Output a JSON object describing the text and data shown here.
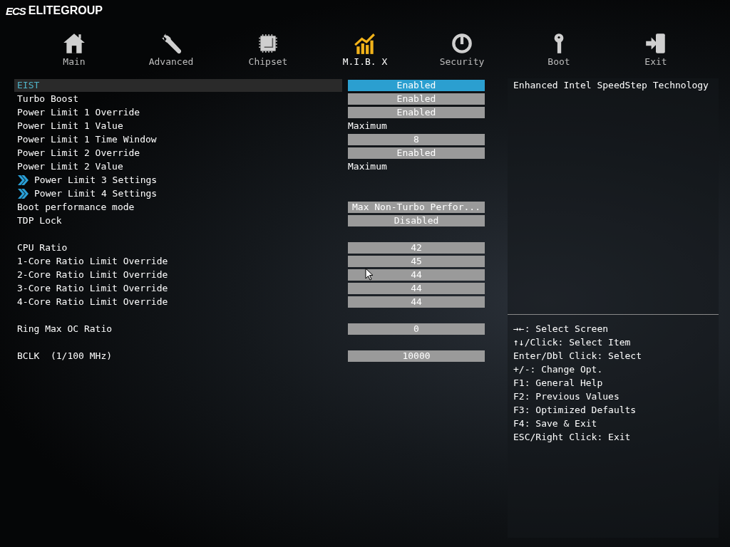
{
  "brand": {
    "logo": "ECS",
    "name": "ELITEGROUP"
  },
  "tabs": [
    {
      "label": "Main",
      "selected": false
    },
    {
      "label": "Advanced",
      "selected": false
    },
    {
      "label": "Chipset",
      "selected": false
    },
    {
      "label": "M.I.B. X",
      "selected": true
    },
    {
      "label": "Security",
      "selected": false
    },
    {
      "label": "Boot",
      "selected": false
    },
    {
      "label": "Exit",
      "selected": false
    }
  ],
  "setting_groups": [
    {
      "items": [
        {
          "kind": "option",
          "label": "EIST",
          "value": "Enabled",
          "selected": true
        },
        {
          "kind": "option",
          "label": "Turbo Boost",
          "value": "Enabled",
          "selected": false
        },
        {
          "kind": "option",
          "label": "Power Limit 1 Override",
          "value": "Enabled",
          "selected": false
        },
        {
          "kind": "text",
          "label": "Power Limit 1 Value",
          "value": "Maximum",
          "selected": false
        },
        {
          "kind": "option",
          "label": "Power Limit 1 Time Window",
          "value": "8",
          "selected": false
        },
        {
          "kind": "option",
          "label": "Power Limit 2 Override",
          "value": "Enabled",
          "selected": false
        },
        {
          "kind": "text",
          "label": "Power Limit 2 Value",
          "value": "Maximum",
          "selected": false
        },
        {
          "kind": "submenu",
          "label": "Power Limit 3 Settings",
          "selected": false
        },
        {
          "kind": "submenu",
          "label": "Power Limit 4 Settings",
          "selected": false
        },
        {
          "kind": "option",
          "label": "Boot performance mode",
          "value": "Max Non-Turbo Perfor...",
          "selected": false
        },
        {
          "kind": "option",
          "label": "TDP Lock",
          "value": "Disabled",
          "selected": false
        }
      ]
    },
    {
      "items": [
        {
          "kind": "option",
          "label": "CPU Ratio",
          "value": "42",
          "selected": false
        },
        {
          "kind": "option",
          "label": "1-Core Ratio Limit Override",
          "value": "45",
          "selected": false
        },
        {
          "kind": "option",
          "label": "2-Core Ratio Limit Override",
          "value": "44",
          "selected": false
        },
        {
          "kind": "option",
          "label": "3-Core Ratio Limit Override",
          "value": "44",
          "selected": false
        },
        {
          "kind": "option",
          "label": "4-Core Ratio Limit Override",
          "value": "44",
          "selected": false
        }
      ]
    },
    {
      "items": [
        {
          "kind": "option",
          "label": "Ring Max OC Ratio",
          "value": "0",
          "selected": false
        }
      ]
    },
    {
      "items": [
        {
          "kind": "option",
          "label": "BCLK  (1/100 MHz)",
          "value": "10000",
          "selected": false
        }
      ]
    }
  ],
  "description": "Enhanced Intel SpeedStep Technology",
  "help": [
    "→←: Select Screen",
    "↑↓/Click: Select Item",
    "Enter/Dbl Click: Select",
    "+/-: Change Opt.",
    "F1: General Help",
    "F2: Previous Values",
    "F3: Optimized Defaults",
    "F4: Save & Exit",
    "ESC/Right Click: Exit"
  ]
}
